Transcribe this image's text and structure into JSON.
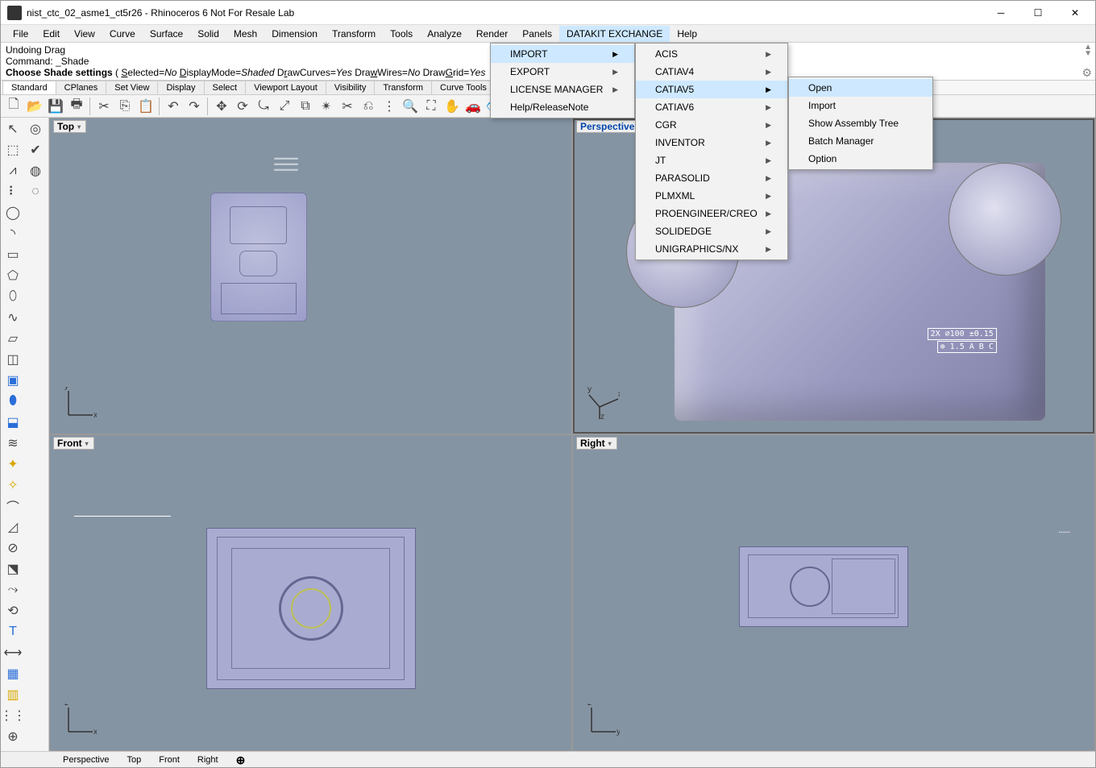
{
  "window": {
    "title": "nist_ctc_02_asme1_ct5r26 - Rhinoceros 6 Not For Resale Lab"
  },
  "menubar": [
    "File",
    "Edit",
    "View",
    "Curve",
    "Surface",
    "Solid",
    "Mesh",
    "Dimension",
    "Transform",
    "Tools",
    "Analyze",
    "Render",
    "Panels",
    "DATAKIT EXCHANGE",
    "Help"
  ],
  "menubar_active": "DATAKIT EXCHANGE",
  "command_lines": [
    "Undoing Drag",
    "Command: _Shade",
    "Choose Shade settings ( Selected=No  DisplayMode=Shaded  DrawCurves=Yes  DrawWires=No  DrawGrid=Yes"
  ],
  "tabs": [
    "Standard",
    "CPlanes",
    "Set View",
    "Display",
    "Select",
    "Viewport Layout",
    "Visibility",
    "Transform",
    "Curve Tools"
  ],
  "tabs_active": "Standard",
  "viewports": {
    "top": "Top",
    "perspective": "Perspective",
    "front": "Front",
    "right": "Right",
    "active": "Perspective"
  },
  "bottom_tabs": [
    "Perspective",
    "Top",
    "Front",
    "Right"
  ],
  "dropdowns": {
    "datakit": {
      "items": [
        "IMPORT",
        "EXPORT",
        "LICENSE MANAGER",
        "Help/ReleaseNote"
      ],
      "has_submenu": {
        "IMPORT": true,
        "EXPORT": true,
        "LICENSE MANAGER": true,
        "Help/ReleaseNote": false
      },
      "highlight": "IMPORT"
    },
    "import": {
      "items": [
        "ACIS",
        "CATIAV4",
        "CATIAV5",
        "CATIAV6",
        "CGR",
        "INVENTOR",
        "JT",
        "PARASOLID",
        "PLMXML",
        "PROENGINEER/CREO",
        "SOLIDEDGE",
        "UNIGRAPHICS/NX"
      ],
      "highlight": "CATIAV5"
    },
    "catiav5": {
      "items": [
        "Open",
        "Import",
        "Show Assembly Tree",
        "Batch Manager",
        "Option"
      ],
      "highlight": "Open"
    }
  },
  "annotations": {
    "persp_label1": "2X  ⌀100 ±0.15",
    "persp_label2": "⊕ 1.5 A B C"
  }
}
